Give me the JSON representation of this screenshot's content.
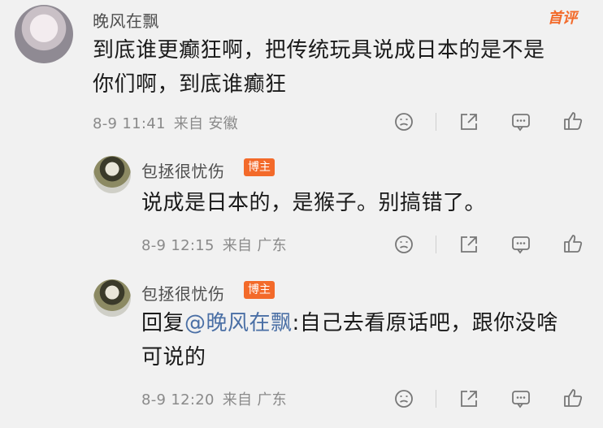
{
  "comments": [
    {
      "username": "晚风在飘",
      "tag": "首评",
      "text_line1": "到底谁更癫狂啊，把传统玩具说成日本的是不是",
      "text_line2": "你们啊，到底谁癫狂",
      "time": "8-9 11:41",
      "source": "来自 安徽"
    },
    {
      "username": "包拯很忧伤",
      "badge": "博主",
      "text_line1": "说成是日本的，是猴子。别搞错了。",
      "time": "8-9 12:15",
      "source": "来自 广东"
    },
    {
      "username": "包拯很忧伤",
      "badge": "博主",
      "reply_prefix": "回复",
      "mention": "@晚风在飘",
      "text_line1_rest": ":自己去看原话吧，跟你没啥",
      "text_line2": "可说的",
      "time": "8-9 12:20",
      "source": "来自 广东"
    }
  ],
  "icons": [
    "dislike-icon",
    "share-icon",
    "comment-icon",
    "like-icon"
  ]
}
